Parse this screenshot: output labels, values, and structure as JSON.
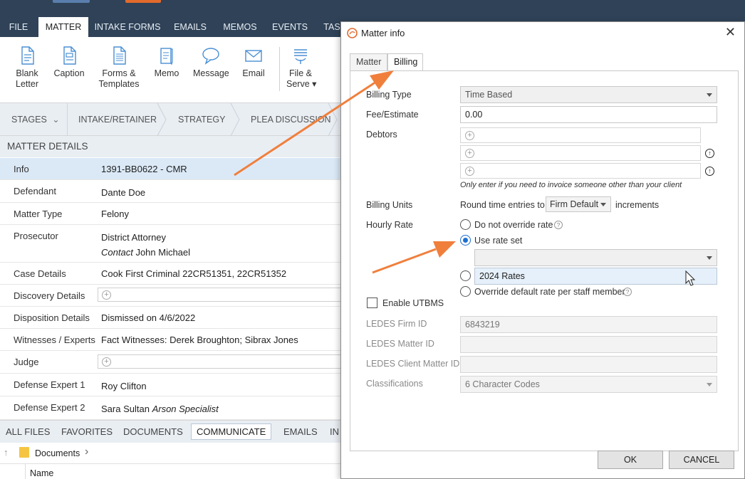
{
  "ribbon": {
    "tabs": [
      "FILE",
      "MATTER",
      "INTAKE FORMS",
      "EMAILS",
      "MEMOS",
      "EVENTS",
      "TAS"
    ],
    "active_tab": "MATTER"
  },
  "toolbar": {
    "blank_letter": "Blank\nLetter",
    "caption": "Caption",
    "forms_templates": "Forms &\nTemplates",
    "memo": "Memo",
    "message": "Message",
    "email": "Email",
    "file_serve": "File &\nServe ▾"
  },
  "stages": {
    "label": "STAGES",
    "items": [
      "INTAKE/RETAINER",
      "STRATEGY",
      "PLEA DISCUSSION"
    ]
  },
  "matter_details": {
    "header": "MATTER DETAILS",
    "rows": [
      {
        "label": "Info",
        "value": "1391-BB0622 - CMR"
      },
      {
        "label": "Defendant",
        "value": "Dante Doe"
      },
      {
        "label": "Matter Type",
        "value": "Felony"
      },
      {
        "label": "Prosecutor",
        "value": "District Attorney",
        "sub_prefix": "Contact",
        "sub_value": "John Michael"
      },
      {
        "label": "Case Details",
        "value": "Cook First Criminal 22CR51351, 22CR51352"
      },
      {
        "label": "Discovery Details",
        "value": ""
      },
      {
        "label": "Disposition Details",
        "value": "Dismissed on 4/6/2022"
      },
      {
        "label": "Witnesses / Experts",
        "value": "Fact Witnesses: Derek Broughton; Sibrax Jones"
      },
      {
        "label": "Judge",
        "value": ""
      },
      {
        "label": "Defense Expert 1",
        "value": "Roy Clifton"
      },
      {
        "label": "Defense Expert 2",
        "value": "Sara Sultan",
        "sub_italic": "Arson Specialist"
      }
    ]
  },
  "bottom_tabs": {
    "items": [
      "ALL FILES",
      "FAVORITES",
      "DOCUMENTS",
      "COMMUNICATE",
      "EMAILS",
      "IN"
    ],
    "active": "COMMUNICATE"
  },
  "path": {
    "folder": "Documents"
  },
  "list_header": {
    "name": "Name"
  },
  "dialog": {
    "title": "Matter info",
    "tabs": [
      "Matter",
      "Billing"
    ],
    "active_tab": "Billing",
    "billing_type_label": "Billing Type",
    "billing_type_value": "Time Based",
    "fee_label": "Fee/Estimate",
    "fee_value": "0.00",
    "debtors_label": "Debtors",
    "debtors_note": "Only enter if you need to invoice someone other than your client",
    "billing_units_label": "Billing Units",
    "billing_units_prefix": "Round time entries to",
    "billing_units_value": "Firm Default",
    "billing_units_suffix": "increments",
    "hourly_rate_label": "Hourly Rate",
    "rate_options": {
      "no_override": "Do not override rate",
      "use_rate_set": "Use rate set",
      "rate_set_option": "2024 Rates",
      "per_staff": "Override default rate per staff member"
    },
    "selected_rate_option": "Use rate set",
    "utbms_label": "Enable UTBMS",
    "ledes_firm_label": "LEDES Firm ID",
    "ledes_firm_value": "6843219",
    "ledes_matter_label": "LEDES Matter ID",
    "ledes_matter_value": "",
    "ledes_client_label": "LEDES Client Matter ID",
    "ledes_client_value": "",
    "classifications_label": "Classifications",
    "classifications_value": "6 Character Codes",
    "ok_label": "OK",
    "cancel_label": "CANCEL"
  },
  "colors": {
    "ribbon_bg": "#2f4257",
    "accent_arrow": "#f07f3c",
    "radio_selected": "#1c6fd1",
    "selected_row": "#dbe9f7"
  }
}
